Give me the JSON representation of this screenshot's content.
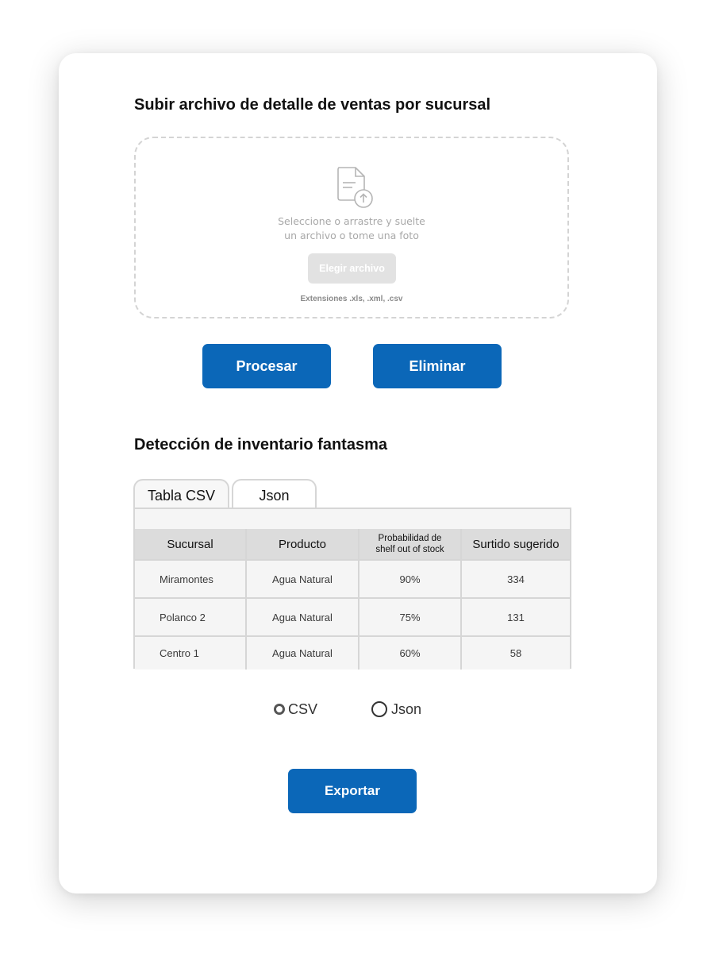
{
  "upload": {
    "title": "Subir archivo de detalle de ventas por sucursal",
    "drop_line1": "Seleccione o arrastre y suelte",
    "drop_line2": "un archivo o tome una foto",
    "choose_label": "Elegir archivo",
    "extensions": "Extensiones .xls, .xml, .csv",
    "icon": "file-upload-icon"
  },
  "actions": {
    "process_label": "Procesar",
    "delete_label": "Eliminar"
  },
  "detection": {
    "title": "Detección de inventario fantasma",
    "tabs": [
      {
        "label": "Tabla CSV",
        "active": true
      },
      {
        "label": "Json",
        "active": false
      }
    ],
    "table": {
      "headers": [
        "Sucursal",
        "Producto",
        "Probabilidad de shelf out of stock",
        "Surtido sugerido"
      ],
      "header_prob_line1": "Probabilidad de",
      "header_prob_line2": "shelf out of stock",
      "rows": [
        [
          "Miramontes",
          "Agua Natural",
          "90%",
          "334"
        ],
        [
          "Polanco 2",
          "Agua Natural",
          "75%",
          "131"
        ],
        [
          "Centro 1",
          "Agua Natural",
          "60%",
          "58"
        ]
      ]
    }
  },
  "export": {
    "options": [
      {
        "label": "CSV",
        "selected": true
      },
      {
        "label": "Json",
        "selected": false
      }
    ],
    "export_label": "Exportar"
  },
  "colors": {
    "primary": "#0b67b8",
    "disabled_button": "#e2e2e2",
    "table_header": "#dcdcdc",
    "table_cell": "#f5f5f5",
    "border": "#d6d6d6"
  }
}
